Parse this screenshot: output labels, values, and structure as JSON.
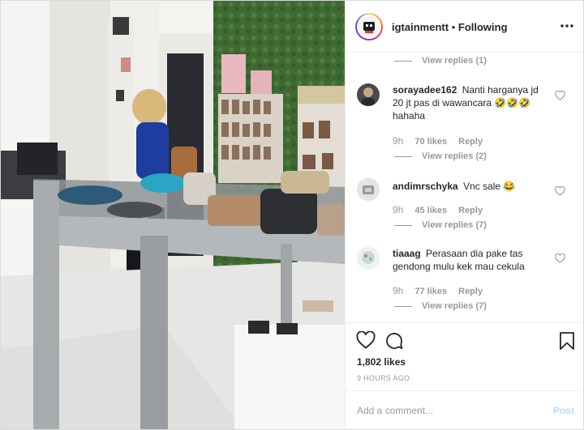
{
  "post": {
    "username": "igtainmentt",
    "follow_status": "Following",
    "separator": "•",
    "likes": "1,802 likes",
    "timestamp": "9 HOURS AGO"
  },
  "comments": {
    "top_view_replies": "View replies (1)",
    "items": [
      {
        "username": "sorayadee162",
        "text": "Nanti harganya jd 20 jt pas di wawancara 🤣🤣🤣 hahaha",
        "time": "9h",
        "likes": "70 likes",
        "reply_label": "Reply",
        "view_replies": "View replies (2)"
      },
      {
        "username": "andimrschyka",
        "text": "Vnc sale 😂",
        "time": "9h",
        "likes": "45 likes",
        "reply_label": "Reply",
        "view_replies": "View replies (7)"
      },
      {
        "username": "tiaaag",
        "text": "Perasaan dia pake tas gendong mulu kek mau cekula",
        "time": "9h",
        "likes": "77 likes",
        "reply_label": "Reply",
        "view_replies": "View replies (7)"
      }
    ]
  },
  "add_comment": {
    "placeholder": "Add a comment...",
    "post_label": "Post"
  },
  "icons": {
    "more": "more-options-icon",
    "heart": "heart-icon",
    "comment": "comment-icon",
    "save": "bookmark-icon"
  },
  "colors": {
    "text": "#262626",
    "secondary": "#999999",
    "post_disabled": "#b2dffc",
    "border": "#efefef"
  }
}
